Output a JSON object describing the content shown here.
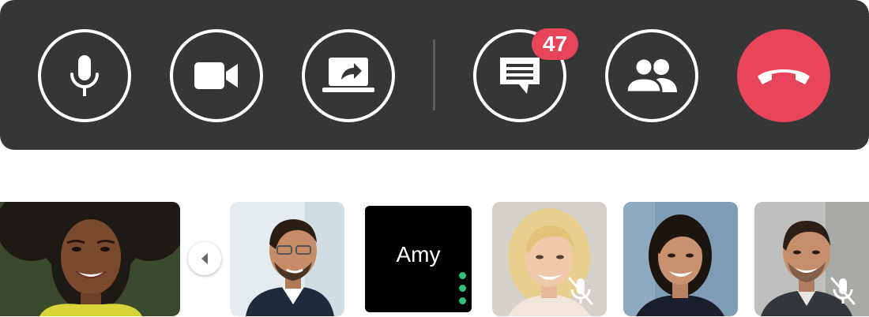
{
  "controls": {
    "mic_icon": "microphone-icon",
    "camera_icon": "video-camera-icon",
    "share_icon": "screen-share-icon",
    "chat_icon": "chat-icon",
    "chat_unread_count": "47",
    "participants_icon": "participants-icon",
    "hangup_icon": "phone-hangup-icon"
  },
  "colors": {
    "bar_background": "#363636",
    "hangup_red": "#e8455a",
    "badge_red": "#e8455a",
    "speaking_green": "#2fc47a"
  },
  "participants": [
    {
      "label": "",
      "muted": false,
      "video": true
    },
    {
      "label": "",
      "muted": false,
      "video": true
    },
    {
      "label": "Amy",
      "muted": false,
      "video": false,
      "speaking": true
    },
    {
      "label": "",
      "muted": true,
      "video": true
    },
    {
      "label": "",
      "muted": false,
      "video": true
    },
    {
      "label": "",
      "muted": true,
      "video": true
    }
  ]
}
